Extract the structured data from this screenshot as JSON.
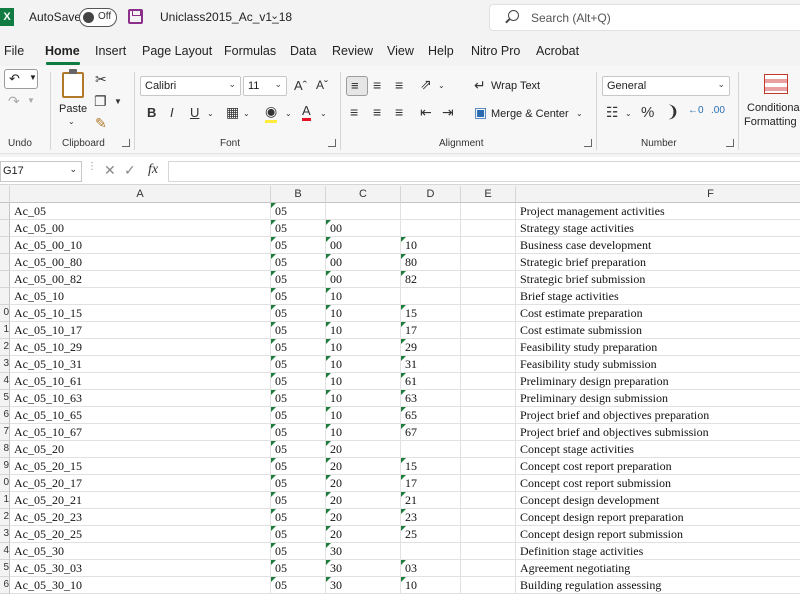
{
  "window": {
    "autosave_label": "AutoSave",
    "autosave_state": "Off",
    "filename": "Uniclass2015_Ac_v1_18",
    "search_placeholder": "Search (Alt+Q)"
  },
  "menu": [
    "File",
    "Home",
    "Insert",
    "Page Layout",
    "Formulas",
    "Data",
    "Review",
    "View",
    "Help",
    "Nitro Pro",
    "Acrobat"
  ],
  "ribbon": {
    "undo_label": "Undo",
    "clipboard_label": "Clipboard",
    "paste_label": "Paste",
    "font_label": "Font",
    "font_name": "Calibri",
    "font_size": "11",
    "alignment_label": "Alignment",
    "wrap_text": "Wrap Text",
    "merge_center": "Merge & Center",
    "number_label": "Number",
    "number_format": "General",
    "conditional_formatting_line1": "Conditional",
    "conditional_formatting_line2": "Formatting"
  },
  "formula_bar": {
    "name_box": "G17",
    "fx": "fx"
  },
  "grid": {
    "columns": [
      "A",
      "B",
      "C",
      "D",
      "E",
      "F"
    ],
    "row_numbers": [
      "",
      "",
      "",
      "",
      "",
      "",
      "0",
      "1",
      "2",
      "3",
      "4",
      "5",
      "6",
      "7",
      "8",
      "9",
      "0",
      "1",
      "2",
      "3",
      "4",
      "5",
      "6",
      "7"
    ],
    "rows": [
      [
        "Ac_05",
        "05",
        "",
        "",
        "",
        "Project management activities"
      ],
      [
        "Ac_05_00",
        "05",
        "00",
        "",
        "",
        "Strategy stage activities"
      ],
      [
        "Ac_05_00_10",
        "05",
        "00",
        "10",
        "",
        "Business case development"
      ],
      [
        "Ac_05_00_80",
        "05",
        "00",
        "80",
        "",
        "Strategic brief preparation"
      ],
      [
        "Ac_05_00_82",
        "05",
        "00",
        "82",
        "",
        "Strategic brief submission"
      ],
      [
        "Ac_05_10",
        "05",
        "10",
        "",
        "",
        "Brief stage activities"
      ],
      [
        "Ac_05_10_15",
        "05",
        "10",
        "15",
        "",
        "Cost estimate preparation"
      ],
      [
        "Ac_05_10_17",
        "05",
        "10",
        "17",
        "",
        "Cost estimate submission"
      ],
      [
        "Ac_05_10_29",
        "05",
        "10",
        "29",
        "",
        "Feasibility study preparation"
      ],
      [
        "Ac_05_10_31",
        "05",
        "10",
        "31",
        "",
        "Feasibility study submission"
      ],
      [
        "Ac_05_10_61",
        "05",
        "10",
        "61",
        "",
        "Preliminary design preparation"
      ],
      [
        "Ac_05_10_63",
        "05",
        "10",
        "63",
        "",
        "Preliminary design submission"
      ],
      [
        "Ac_05_10_65",
        "05",
        "10",
        "65",
        "",
        "Project brief and objectives preparation"
      ],
      [
        "Ac_05_10_67",
        "05",
        "10",
        "67",
        "",
        "Project brief and objectives submission"
      ],
      [
        "Ac_05_20",
        "05",
        "20",
        "",
        "",
        "Concept stage activities"
      ],
      [
        "Ac_05_20_15",
        "05",
        "20",
        "15",
        "",
        "Concept cost report preparation"
      ],
      [
        "Ac_05_20_17",
        "05",
        "20",
        "17",
        "",
        "Concept cost report submission"
      ],
      [
        "Ac_05_20_21",
        "05",
        "20",
        "21",
        "",
        "Concept design development"
      ],
      [
        "Ac_05_20_23",
        "05",
        "20",
        "23",
        "",
        "Concept design report preparation"
      ],
      [
        "Ac_05_20_25",
        "05",
        "20",
        "25",
        "",
        "Concept design report submission"
      ],
      [
        "Ac_05_30",
        "05",
        "30",
        "",
        "",
        "Definition stage activities"
      ],
      [
        "Ac_05_30_03",
        "05",
        "30",
        "03",
        "",
        "Agreement negotiating"
      ],
      [
        "Ac_05_30_10",
        "05",
        "30",
        "10",
        "",
        "Building regulation assessing"
      ]
    ]
  },
  "colors": {
    "excel_green": "#107c41",
    "error_triangle": "#1e7d3c"
  }
}
